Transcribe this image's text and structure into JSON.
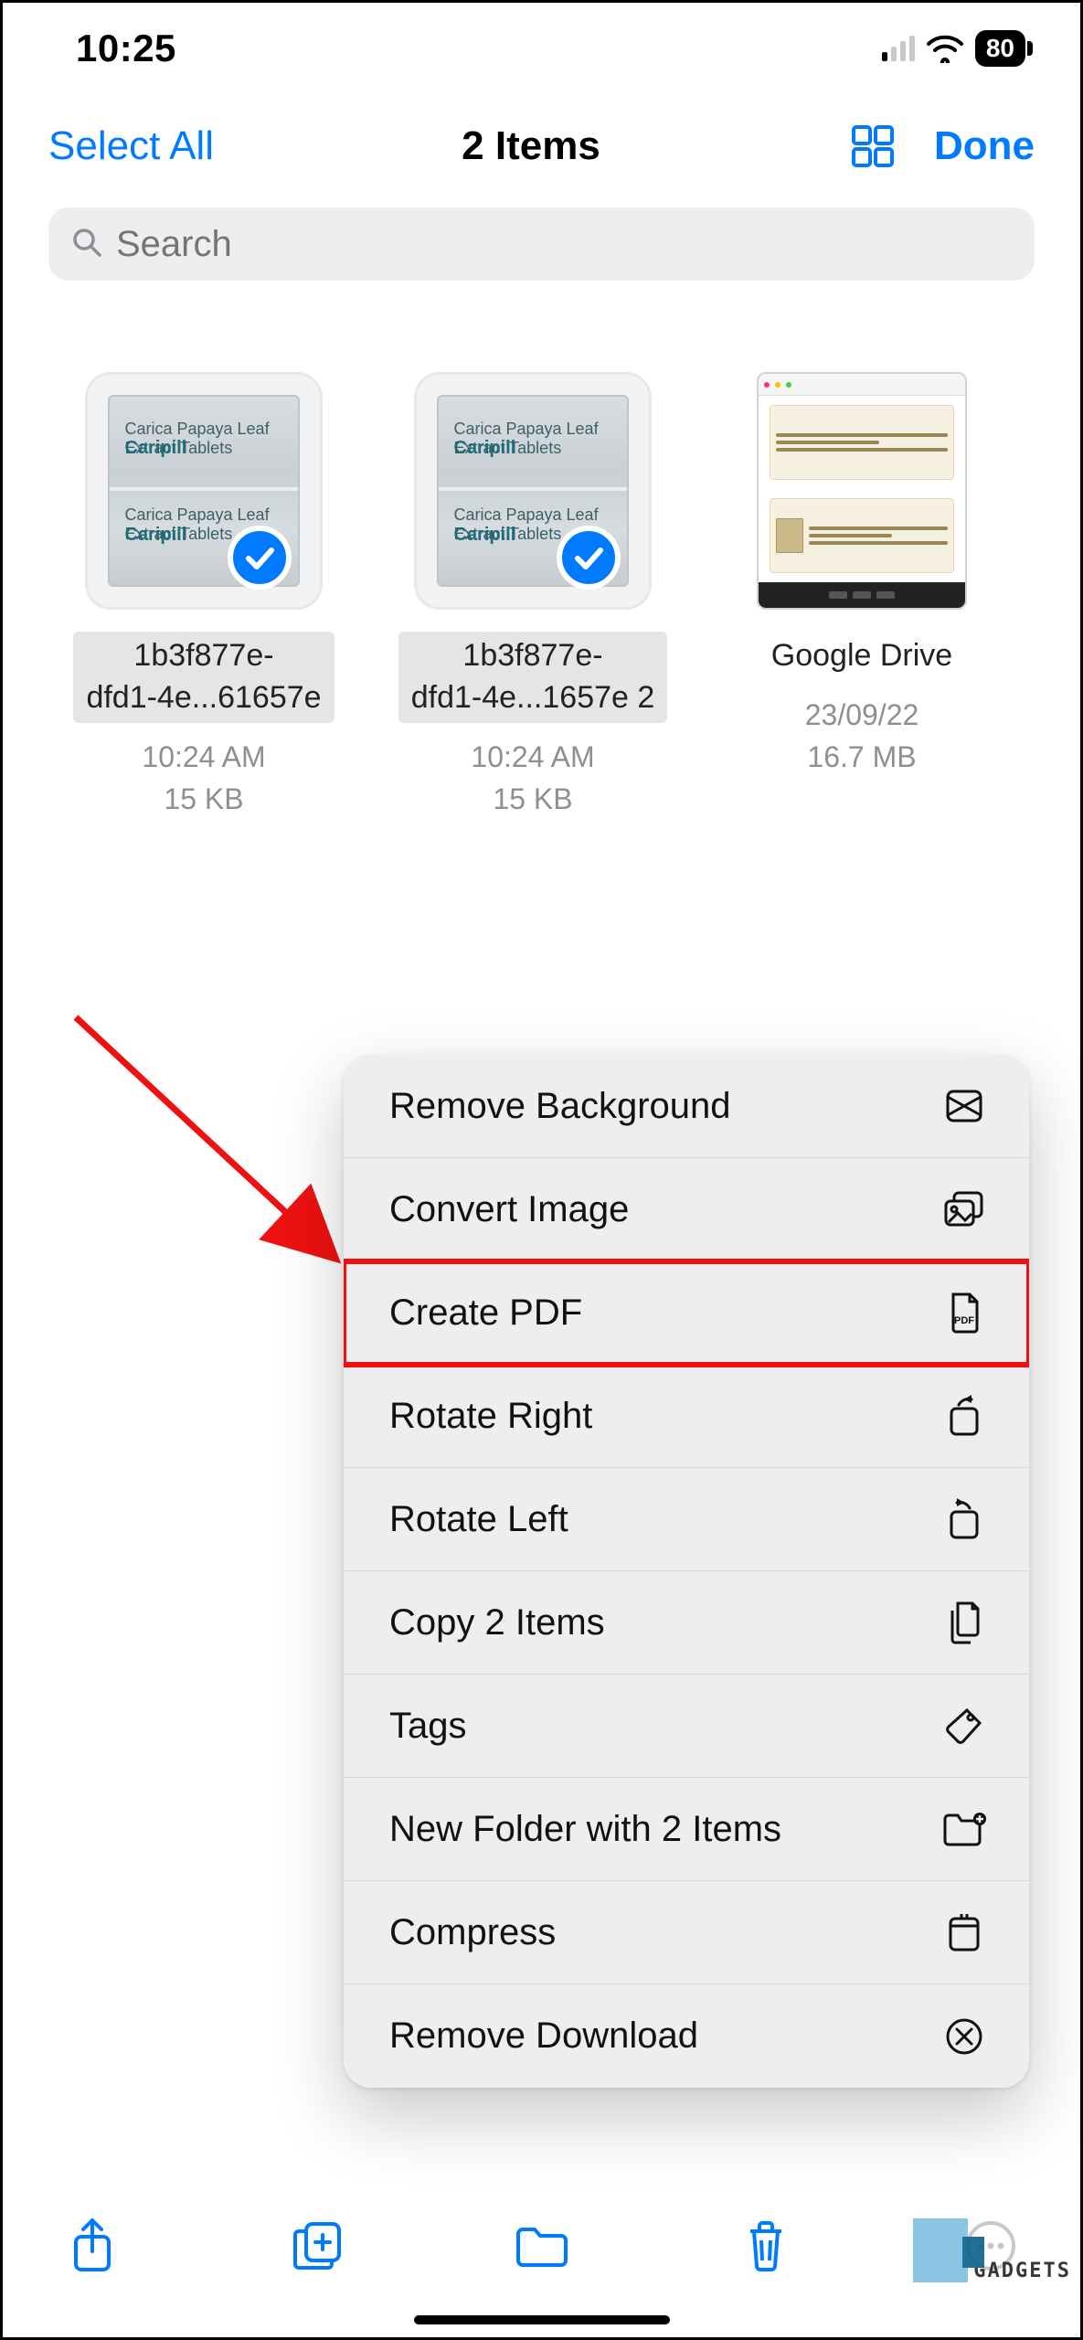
{
  "status": {
    "time": "10:25",
    "battery": "80"
  },
  "nav": {
    "select_all": "Select All",
    "title": "2 Items",
    "done": "Done"
  },
  "search": {
    "placeholder": "Search"
  },
  "files": [
    {
      "name_line1": "1b3f877e-",
      "name_line2": "dfd1-4e...61657e",
      "time": "10:24 AM",
      "size": "15 KB",
      "selected": true,
      "kind": "image"
    },
    {
      "name_line1": "1b3f877e-",
      "name_line2": "dfd1-4e...1657e 2",
      "time": "10:24 AM",
      "size": "15 KB",
      "selected": true,
      "kind": "image"
    },
    {
      "name_line1": "Google Drive",
      "time": "23/09/22",
      "size": "16.7 MB",
      "selected": false,
      "kind": "pdf"
    }
  ],
  "thumb_text": {
    "small": "Carica Papaya Leaf Extract Tablets",
    "brand": "Caripill"
  },
  "menu": {
    "items": [
      {
        "label": "Remove Background",
        "icon": "remove-bg-icon",
        "highlight": false
      },
      {
        "label": "Convert Image",
        "icon": "convert-image-icon",
        "highlight": false
      },
      {
        "label": "Create PDF",
        "icon": "create-pdf-icon",
        "highlight": true
      },
      {
        "label": "Rotate Right",
        "icon": "rotate-right-icon",
        "highlight": false
      },
      {
        "label": "Rotate Left",
        "icon": "rotate-left-icon",
        "highlight": false
      },
      {
        "label": "Copy 2 Items",
        "icon": "copy-icon",
        "highlight": false
      },
      {
        "label": "Tags",
        "icon": "tag-icon",
        "highlight": false
      },
      {
        "label": "New Folder with 2 Items",
        "icon": "new-folder-icon",
        "highlight": false
      },
      {
        "label": "Compress",
        "icon": "compress-icon",
        "highlight": false
      },
      {
        "label": "Remove Download",
        "icon": "remove-download-icon",
        "highlight": false
      }
    ]
  },
  "watermark": "GADGETS",
  "colors": {
    "accent": "#007aff",
    "highlight_border": "#e11"
  }
}
